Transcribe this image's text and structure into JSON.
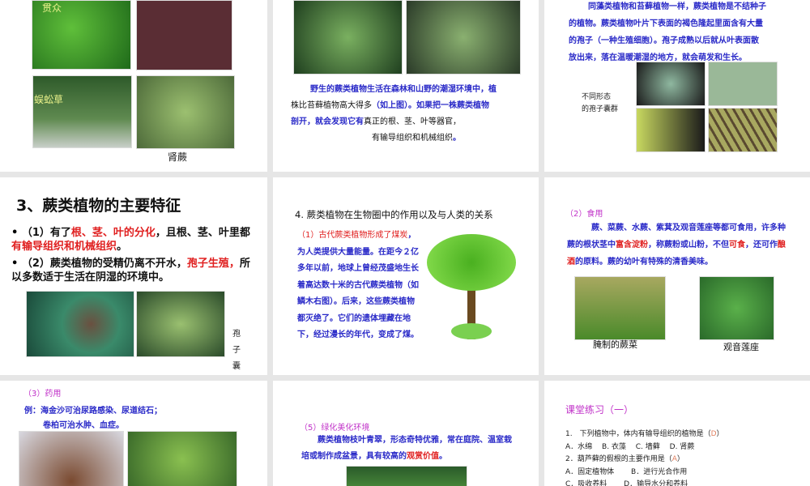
{
  "slides": [
    {
      "labels": {
        "img1": "贯众",
        "img3": "蜈蚣草",
        "caption": "肾蕨"
      }
    },
    {
      "text": [
        [
          {
            "t": "野生的蕨类植物生活在森林和山野的潮湿环境中，植",
            "c": "b"
          }
        ],
        [
          {
            "t": "株比苔藓植物高大得多",
            "c": "k"
          },
          {
            "t": "（如上图）。如果把一株蕨类植物",
            "c": "b"
          }
        ],
        [
          {
            "t": "剖开，就会发现它有",
            "c": "b"
          },
          {
            "t": "真正的根、茎、叶等器官，",
            "c": "k"
          }
        ],
        [
          {
            "t": "有输导组织和机械组织",
            "c": "k"
          },
          {
            "t": "。",
            "c": "b"
          }
        ]
      ]
    },
    {
      "text": [
        "同藻类植物和苔藓植物一样，蕨类植物是不结种子",
        "的植物。蕨类植物叶片下表面的褐色隆起里面含有大量",
        "的孢子（一种生殖细胞）。孢子成熟以后就从叶表面散",
        "放出来，落在温暖潮湿的地方，就会萌发和生长。"
      ],
      "side_label": [
        "不同形态",
        "的孢子囊群"
      ]
    },
    {
      "title": "3、蕨类植物的主要特征",
      "bullets": [
        [
          {
            "t": "（1）有了",
            "c": "k"
          },
          {
            "t": "根、茎、叶的分化",
            "c": "r"
          },
          {
            "t": "，且根、茎、叶里都",
            "c": "k"
          },
          {
            "t": "有输导组织和机械组织",
            "c": "r"
          },
          {
            "t": "。",
            "c": "k"
          }
        ],
        [
          {
            "t": "（2）蕨类植物的受精仍离不开水，",
            "c": "k"
          },
          {
            "t": "孢子生殖，",
            "c": "r"
          },
          {
            "t": "所以多数适于生活在阴湿的环境中。",
            "c": "k"
          }
        ]
      ],
      "side_label": [
        "孢",
        "子",
        "囊"
      ]
    },
    {
      "title": "4. 蕨类植物在生物圈中的作用以及与人类的关系",
      "text": [
        {
          "t": "（1）古代蕨类植物形成了煤炭",
          "c": "r"
        },
        {
          "t": "，为人类提供大量能量。在距今２亿多年以前，地球上曾经茂盛地生长着高达数十米的古代蕨类植物（如鳞木右图）。后来，这些蕨类植物都灭绝了。它们的遗体埋藏在地下，经过漫长的年代，变成了煤。",
          "c": "b"
        }
      ]
    },
    {
      "heading": "（2）食用",
      "text": [
        {
          "t": "　　　蕨、菜蕨、水蕨、紫萁及观音莲座等都可食用，许多种蕨的根状茎中",
          "c": "b"
        },
        {
          "t": "富含淀粉",
          "c": "r"
        },
        {
          "t": "，称蕨粉或山粉，不但",
          "c": "b"
        },
        {
          "t": "可食",
          "c": "r"
        },
        {
          "t": "，还可作",
          "c": "b"
        },
        {
          "t": "酿酒",
          "c": "r"
        },
        {
          "t": "的原料。蕨的幼叶有特殊的清香美味。",
          "c": "b"
        }
      ],
      "captions": [
        "腌制的蕨菜",
        "观音莲座"
      ]
    },
    {
      "heading": "（3）药用",
      "lines": [
        "例：海金沙可治尿路感染、尿道结石；",
        "卷柏可治水肿、血症。"
      ]
    },
    {
      "heading": "（5）绿化美化环境",
      "text": [
        {
          "t": "　　蕨类植物枝叶青翠，形态奇特优雅，常在庭院、温室栽培或制作成盆景，具有较高的",
          "c": "b"
        },
        {
          "t": "观赏价值",
          "c": "r"
        },
        {
          "t": "。",
          "c": "b"
        }
      ]
    },
    {
      "heading": "课堂练习（一）",
      "q1": {
        "q": "1.　下列植物中，体内有输导组织的植物是（",
        "a": "D",
        "end": "）"
      },
      "q1_opts": "A．水绵　 B. 衣藻　 C. 墙藓　 D. 肾蕨",
      "q2": {
        "q": "2．葫芦藓的假根的主要作用是（",
        "a": "A",
        "end": "）"
      },
      "q2_opts": "A．固定植物体　　 B．进行光合作用",
      "q2_opts2": "C．吸收养料　　 D．输导水分和养料"
    }
  ]
}
